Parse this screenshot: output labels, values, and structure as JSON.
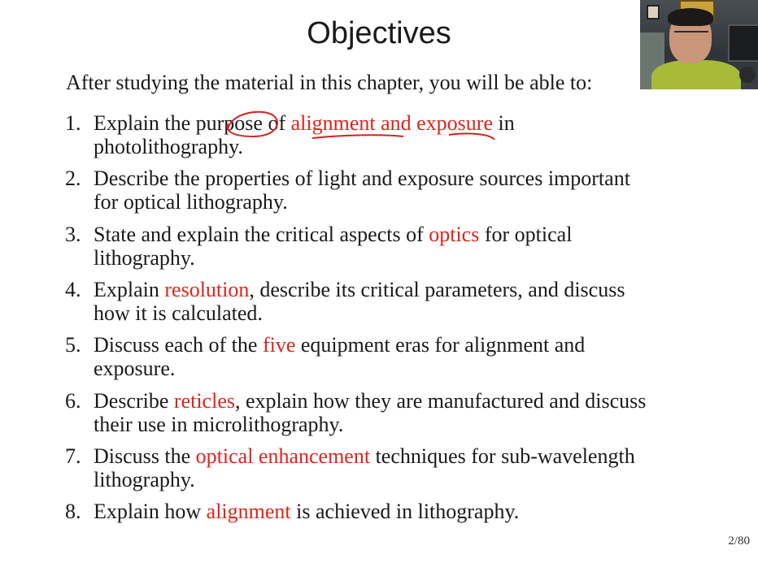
{
  "slide": {
    "title": "Objectives",
    "intro": "After studying the material in this chapter, you will be able to:",
    "objectives": [
      {
        "num": "1.",
        "line1": [
          {
            "t": "Explain the purpose of ",
            "c": ""
          },
          {
            "t": "alignment and exposure",
            "c": "red"
          },
          {
            "t": " in",
            "c": ""
          }
        ],
        "line2": [
          {
            "t": "photolithography.",
            "c": ""
          }
        ]
      },
      {
        "num": "2.",
        "line1": [
          {
            "t": "Describe the properties of light and exposure sources important",
            "c": ""
          }
        ],
        "line2": [
          {
            "t": "for optical lithography.",
            "c": ""
          }
        ]
      },
      {
        "num": "3.",
        "line1": [
          {
            "t": "State and explain the critical aspects of ",
            "c": ""
          },
          {
            "t": "optics",
            "c": "red"
          },
          {
            "t": " for optical",
            "c": ""
          }
        ],
        "line2": [
          {
            "t": "lithography.",
            "c": ""
          }
        ]
      },
      {
        "num": "4.",
        "line1": [
          {
            "t": "Explain ",
            "c": ""
          },
          {
            "t": "resolution",
            "c": "red"
          },
          {
            "t": ", describe its critical parameters, and discuss",
            "c": ""
          }
        ],
        "line2": [
          {
            "t": "how it is calculated.",
            "c": ""
          }
        ]
      },
      {
        "num": "5.",
        "line1": [
          {
            "t": "Discuss each of the ",
            "c": ""
          },
          {
            "t": "five",
            "c": "red"
          },
          {
            "t": " equipment eras for alignment and",
            "c": ""
          }
        ],
        "line2": [
          {
            "t": "exposure.",
            "c": ""
          }
        ]
      },
      {
        "num": "6.",
        "line1": [
          {
            "t": "Describe ",
            "c": ""
          },
          {
            "t": "reticles",
            "c": "red"
          },
          {
            "t": ", explain how they are manufactured and discuss",
            "c": ""
          }
        ],
        "line2": [
          {
            "t": "their use in microlithography.",
            "c": ""
          }
        ]
      },
      {
        "num": "7.",
        "line1": [
          {
            "t": "Discuss the ",
            "c": ""
          },
          {
            "t": "optical enhancement",
            "c": "red"
          },
          {
            "t": " techniques for sub-wavelength",
            "c": ""
          }
        ],
        "line2": [
          {
            "t": "lithography.",
            "c": ""
          }
        ]
      },
      {
        "num": "8.",
        "line1": [
          {
            "t": "Explain how ",
            "c": ""
          },
          {
            "t": "alignment",
            "c": "red"
          },
          {
            "t": " is achieved in lithography.",
            "c": ""
          }
        ],
        "line2": []
      }
    ],
    "page_number": "2/80"
  },
  "colors": {
    "text": "#1a1a1a",
    "highlight": "#e0231c",
    "annotation": "#d42020"
  }
}
